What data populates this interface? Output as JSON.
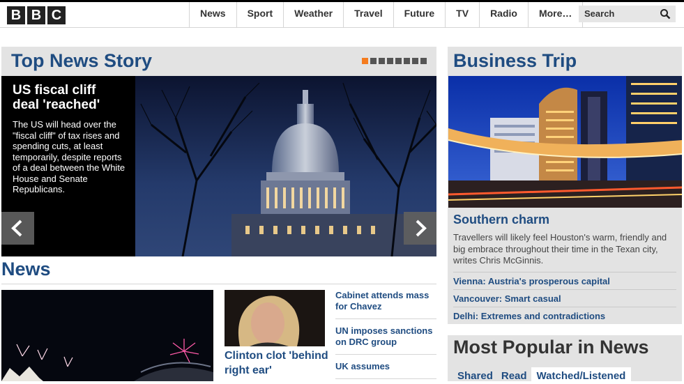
{
  "header": {
    "logo_letters": [
      "B",
      "B",
      "C"
    ],
    "nav": [
      "News",
      "Sport",
      "Weather",
      "Travel",
      "Future",
      "TV",
      "Radio",
      "More…"
    ],
    "search_label": "Search"
  },
  "top_story": {
    "section_title": "Top News Story",
    "slide_count": 8,
    "active_slide": 1,
    "headline": "US fiscal cliff deal 'reached'",
    "summary": "The US will head over the \"fiscal cliff\" of tax rises and spending cuts, at least temporarily, despite reports of a deal between the White House and Senate Republicans."
  },
  "news": {
    "section_title": "News",
    "feature_headline": "Clinton clot 'behind right ear'",
    "side_links": [
      "Cabinet attends mass for Chavez",
      "UN imposes sanctions on DRC group",
      "UK assumes"
    ]
  },
  "business": {
    "section_title": "Business Trip",
    "headline": "Southern charm",
    "summary": "Travellers will likely feel Houston's warm, friendly and big embrace throughout their time in the Texan city, writes Chris McGinnis.",
    "links": [
      "Vienna: Austria's prosperous capital",
      "Vancouver: Smart casual",
      "Delhi: Extremes and contradictions"
    ]
  },
  "popular": {
    "section_title": "Most Popular in News",
    "tabs": [
      "Shared",
      "Read",
      "Watched/Listened"
    ],
    "active_tab": "Watched/Listened"
  },
  "colors": {
    "brand_blue": "#1f4c81",
    "active_dot": "#f57c1f",
    "panel_gray": "#e3e3e3"
  }
}
